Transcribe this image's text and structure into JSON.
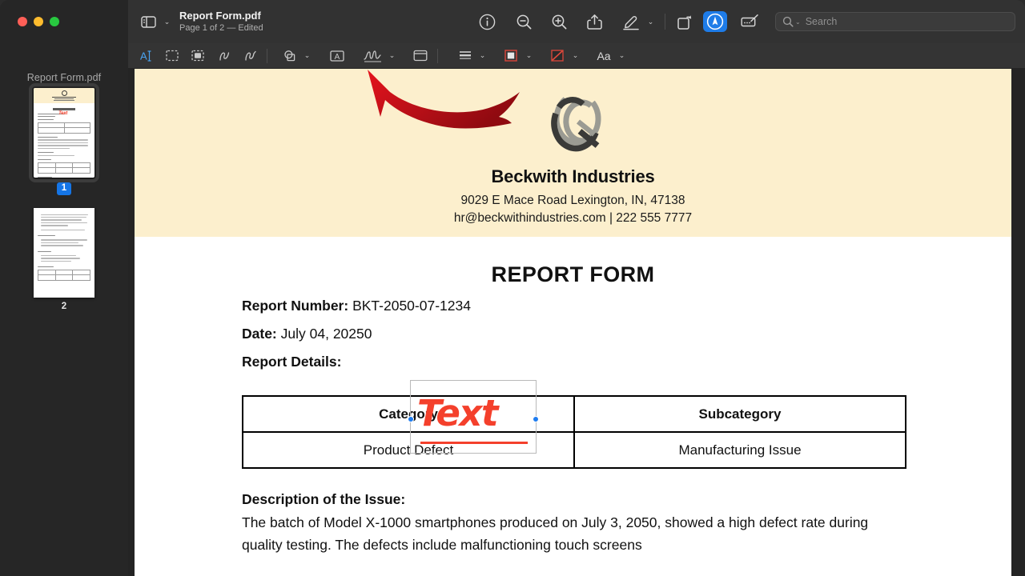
{
  "window": {
    "traffic_lights": [
      "close",
      "minimize",
      "maximize"
    ],
    "colors": {
      "accent": "#1e7ce8",
      "annotation_red": "#f4402c",
      "band": "#fcefcd",
      "arrow_red": "#c4111b"
    }
  },
  "sidebar": {
    "title": "Report Form.pdf",
    "thumbnails": [
      {
        "page_label": "1",
        "selected": true
      },
      {
        "page_label": "2",
        "selected": false
      }
    ]
  },
  "toolbar": {
    "sidebar_toggle_icon": "sidebar-icon",
    "sidebar_toggle_chevron": "⌄",
    "document_title": "Report Form.pdf",
    "document_subtitle": "Page 1 of 2 — Edited",
    "items": [
      {
        "name": "info-button",
        "icon": "info-circle-icon"
      },
      {
        "name": "zoom-out-button",
        "icon": "magnifier-minus-icon"
      },
      {
        "name": "zoom-in-button",
        "icon": "magnifier-plus-icon"
      },
      {
        "name": "share-button",
        "icon": "share-arrow-icon"
      },
      {
        "name": "highlight-button",
        "icon": "highlighter-pen-icon"
      },
      {
        "name": "highlight-options-button",
        "icon": "chevron-down-icon"
      },
      {
        "name": "rotate-button",
        "icon": "rotate-right-icon"
      },
      {
        "name": "markup-button",
        "icon": "markup-pen-circle-icon"
      },
      {
        "name": "annotate-button",
        "icon": "annotate-tablet-icon"
      }
    ],
    "search": {
      "placeholder": "Search",
      "value": "",
      "icon": "search-icon"
    }
  },
  "markup_bar": {
    "items": [
      {
        "name": "text-selection-tool",
        "icon": "text-cursor-icon",
        "active": true
      },
      {
        "name": "rectangular-selection-tool",
        "icon": "dashed-rectangle-icon",
        "active": false
      },
      {
        "name": "instant-alpha-tool",
        "icon": "filled-dashed-rectangle-icon",
        "active": false
      },
      {
        "name": "sketch-tool",
        "icon": "squiggle-icon",
        "active": false
      },
      {
        "name": "draw-tool",
        "icon": "squiggle-pen-icon",
        "active": false
      },
      {
        "name": "shapes-tool",
        "icon": "shapes-icon",
        "active": false
      },
      {
        "name": "shapes-menu",
        "icon": "chevron-down-icon",
        "active": false
      },
      {
        "name": "text-tool",
        "icon": "letter-a-box-icon",
        "active": false
      },
      {
        "name": "sign-tool",
        "icon": "signature-icon",
        "active": false
      },
      {
        "name": "sign-menu",
        "icon": "chevron-down-icon",
        "active": false
      },
      {
        "name": "note-tool",
        "icon": "note-box-icon",
        "active": false
      },
      {
        "name": "border-style-tool",
        "icon": "line-stack-icon",
        "active": false
      },
      {
        "name": "border-style-menu",
        "icon": "chevron-down-icon",
        "active": false
      },
      {
        "name": "border-color-tool",
        "icon": "border-color-swatch-icon",
        "active": false
      },
      {
        "name": "border-color-menu",
        "icon": "chevron-down-icon",
        "active": false
      },
      {
        "name": "fill-color-tool",
        "icon": "fill-color-swatch-icon",
        "active": false
      },
      {
        "name": "fill-color-menu",
        "icon": "chevron-down-icon",
        "active": false
      }
    ],
    "font_button_label": "Aa",
    "font_button_chevron": "⌄"
  },
  "document": {
    "company": {
      "name": "Beckwith Industries",
      "address": "9029 E Mace Road Lexington, IN, 47138",
      "contact": "hr@beckwithindustries.com | 222 555 7777",
      "logo_icon": "double-ring-q-logo-icon"
    },
    "arrow_annotation_icon": "curved-red-arrow-icon",
    "form_title": "REPORT FORM",
    "fields": [
      {
        "label": "Report Number:",
        "value": "BKT-2050-07-1234"
      },
      {
        "label": "Date:",
        "value": "July 04, 20250"
      },
      {
        "label": "Report Details:",
        "value": ""
      }
    ],
    "table": {
      "headers": [
        "Category",
        "Subcategory"
      ],
      "rows": [
        [
          "Product Defect",
          "Manufacturing Issue"
        ]
      ]
    },
    "description_heading": "Description of the Issue:",
    "description_text": "The batch of Model X-1000 smartphones produced on July 3, 2050, showed a high defect rate during quality testing. The defects include malfunctioning touch screens",
    "text_annotation": {
      "value": "Text",
      "selected": true
    }
  }
}
